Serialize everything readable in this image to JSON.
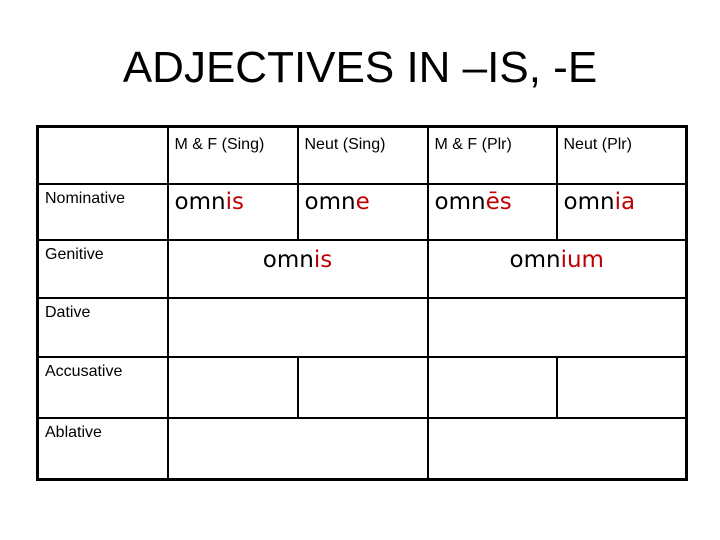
{
  "title": "ADJECTIVES IN –IS, -E",
  "colors": {
    "ending": "#c00000",
    "stem": "#000000",
    "border": "#000000"
  },
  "table": {
    "headers": [
      "",
      "M & F (Sing)",
      "Neut (Sing)",
      "M & F (Plr)",
      "Neut (Plr)"
    ],
    "cases": [
      "Nominative",
      "Genitive",
      "Dative",
      "Accusative",
      "Ablative"
    ],
    "nominative": {
      "mf_sing": {
        "stem": "omn",
        "ending": "is"
      },
      "neut_sing": {
        "stem": "omn",
        "ending": "e"
      },
      "mf_plr": {
        "stem": "omn",
        "ending": "ēs"
      },
      "neut_plr": {
        "stem": "omn",
        "ending": "ia"
      }
    },
    "genitive": {
      "sing": {
        "stem": "omn",
        "ending": "is"
      },
      "plr": {
        "stem": "omn",
        "ending": "ium"
      }
    }
  }
}
